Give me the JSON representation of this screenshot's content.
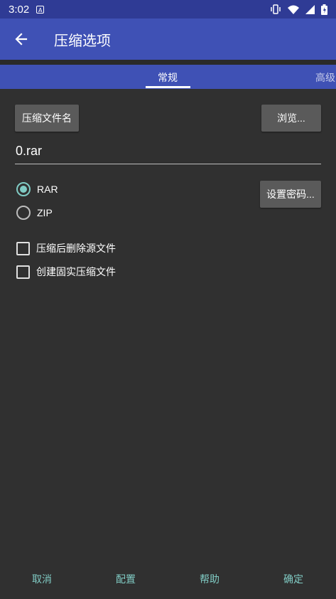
{
  "status_bar": {
    "time": "3:02",
    "notification_glyph": "A",
    "icons": [
      "vibrate-icon",
      "wifi-icon",
      "signal-icon",
      "battery-icon"
    ]
  },
  "toolbar": {
    "title": "压缩选项",
    "back_icon": "arrow-left-icon"
  },
  "tabs": [
    {
      "label": "常规",
      "selected": true
    },
    {
      "label": "高级",
      "selected": false
    }
  ],
  "archive_name_button": "压缩文件名",
  "browse_button": "浏览...",
  "filename_value": "0.rar",
  "format_options": [
    {
      "label": "RAR",
      "checked": true
    },
    {
      "label": "ZIP",
      "checked": false
    }
  ],
  "set_password_button": "设置密码...",
  "options": [
    {
      "label": "压缩后删除源文件",
      "checked": false
    },
    {
      "label": "创建固实压缩文件",
      "checked": false
    }
  ],
  "bottom_buttons": {
    "cancel": "取消",
    "profiles": "配置",
    "help": "帮助",
    "ok": "确定"
  },
  "colors": {
    "app_bar": "#3f51b5",
    "status_bar": "#2f3b95",
    "background": "#303030",
    "accent": "#80cbc4"
  }
}
